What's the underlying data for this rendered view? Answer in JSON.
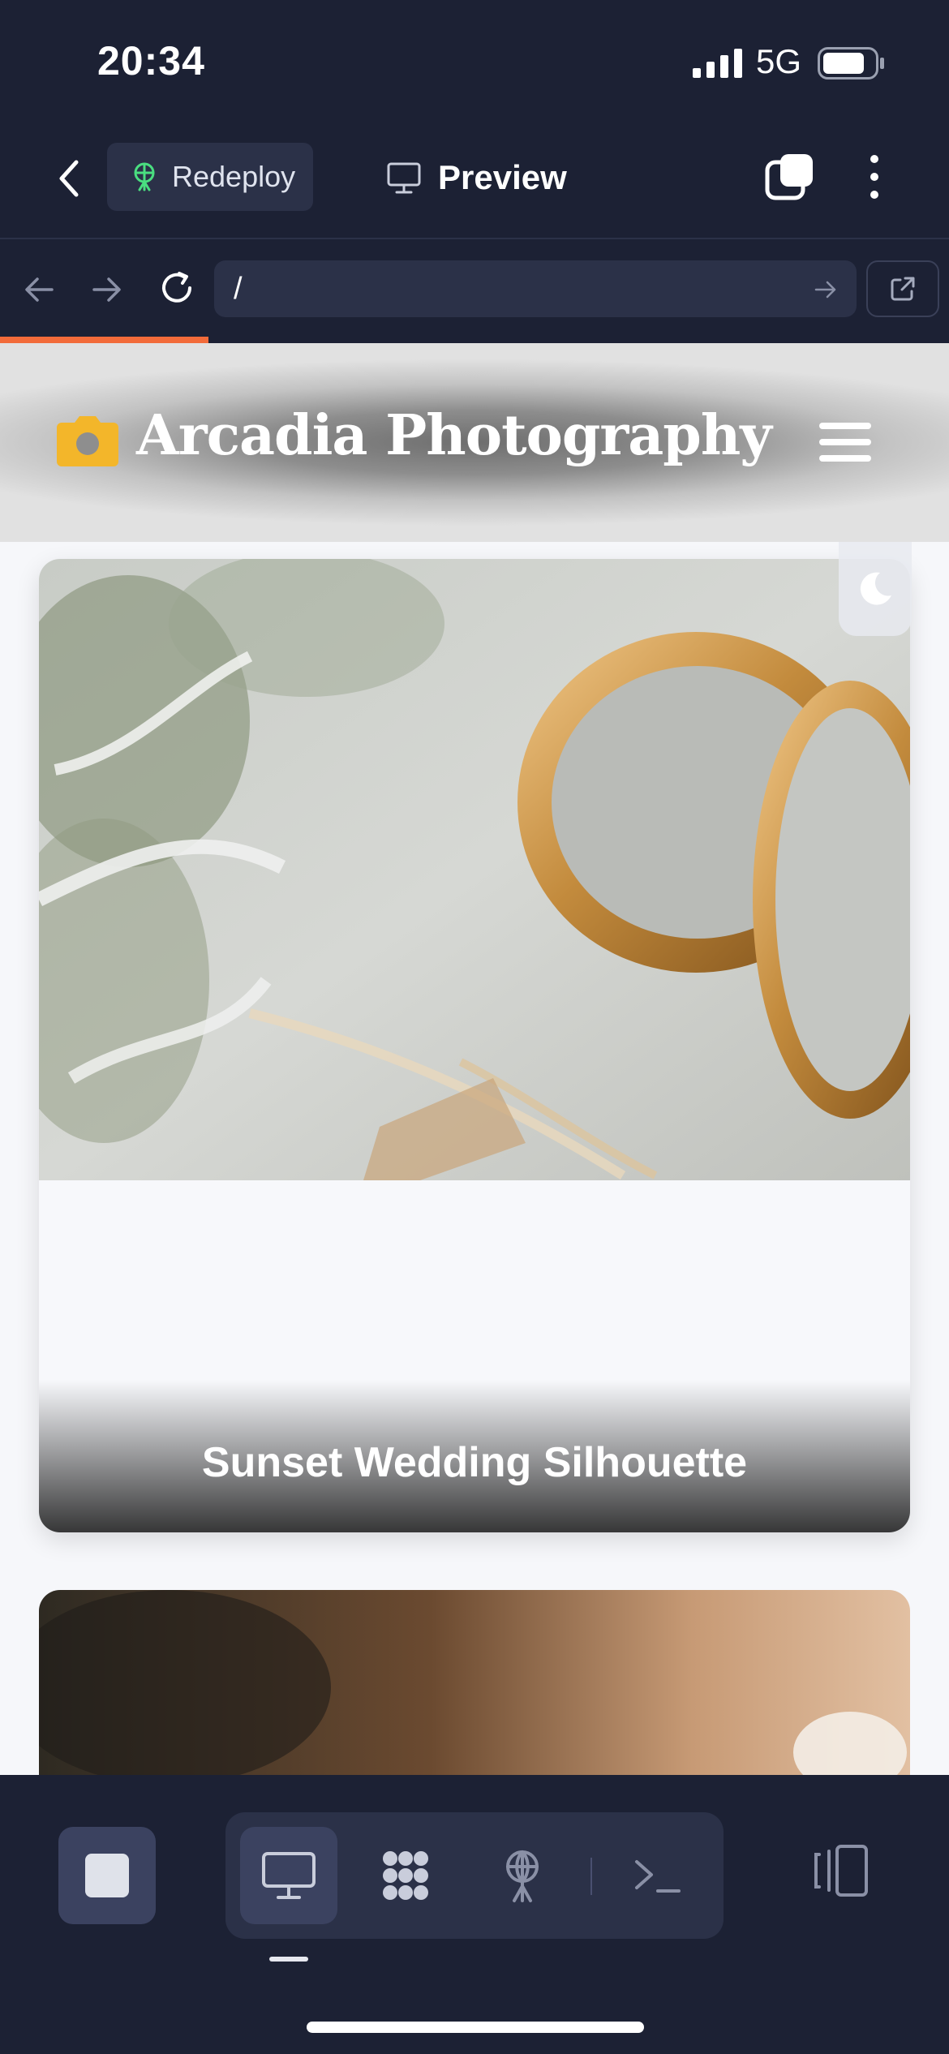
{
  "status_bar": {
    "time": "20:34",
    "network": "5G",
    "icons": [
      "cellular-signal-icon",
      "battery-icon"
    ]
  },
  "app_bar": {
    "back_icon": "chevron-left-icon",
    "redeploy_label": "Redeploy",
    "redeploy_icon": "antenna-icon",
    "redeploy_icon_color": "#4ade80",
    "preview_label": "Preview",
    "preview_icon": "monitor-icon",
    "tabs_icon": "tabs-icon",
    "more_icon": "more-vertical-icon"
  },
  "browser_nav": {
    "back_icon": "arrow-left-icon",
    "forward_icon": "arrow-right-icon",
    "reload_icon": "reload-icon",
    "url_value": "/",
    "go_icon": "arrow-right-icon",
    "open_external_icon": "external-link-icon",
    "load_progress": 0.22,
    "load_color": "#f26b3a"
  },
  "site": {
    "title": "Arcadia Photography",
    "logo_icon": "camera-icon",
    "logo_color": "#f3b62a",
    "menu_icon": "hamburger-menu-icon",
    "theme_toggle_icon": "moon-icon",
    "cards": [
      {
        "caption": "Sunset Wedding Silhouette",
        "image": "gold wedding rings on linen with dusty miller"
      },
      {
        "caption": "",
        "image": "warm toned floral wedding photo (partially visible)"
      }
    ]
  },
  "dock": {
    "stop_icon": "stop-icon",
    "modes": [
      {
        "name": "preview",
        "icon": "monitor-icon",
        "active": true
      },
      {
        "name": "canvas",
        "icon": "nodes-icon",
        "active": false
      },
      {
        "name": "deploy",
        "icon": "antenna-icon",
        "active": false
      },
      {
        "name": "terminal",
        "icon": "terminal-icon",
        "active": false
      }
    ],
    "layout_icon": "split-layout-icon"
  },
  "colors": {
    "chrome_bg": "#1c2134",
    "chrome_surface": "#2b3148",
    "chrome_active": "#3b4260"
  }
}
